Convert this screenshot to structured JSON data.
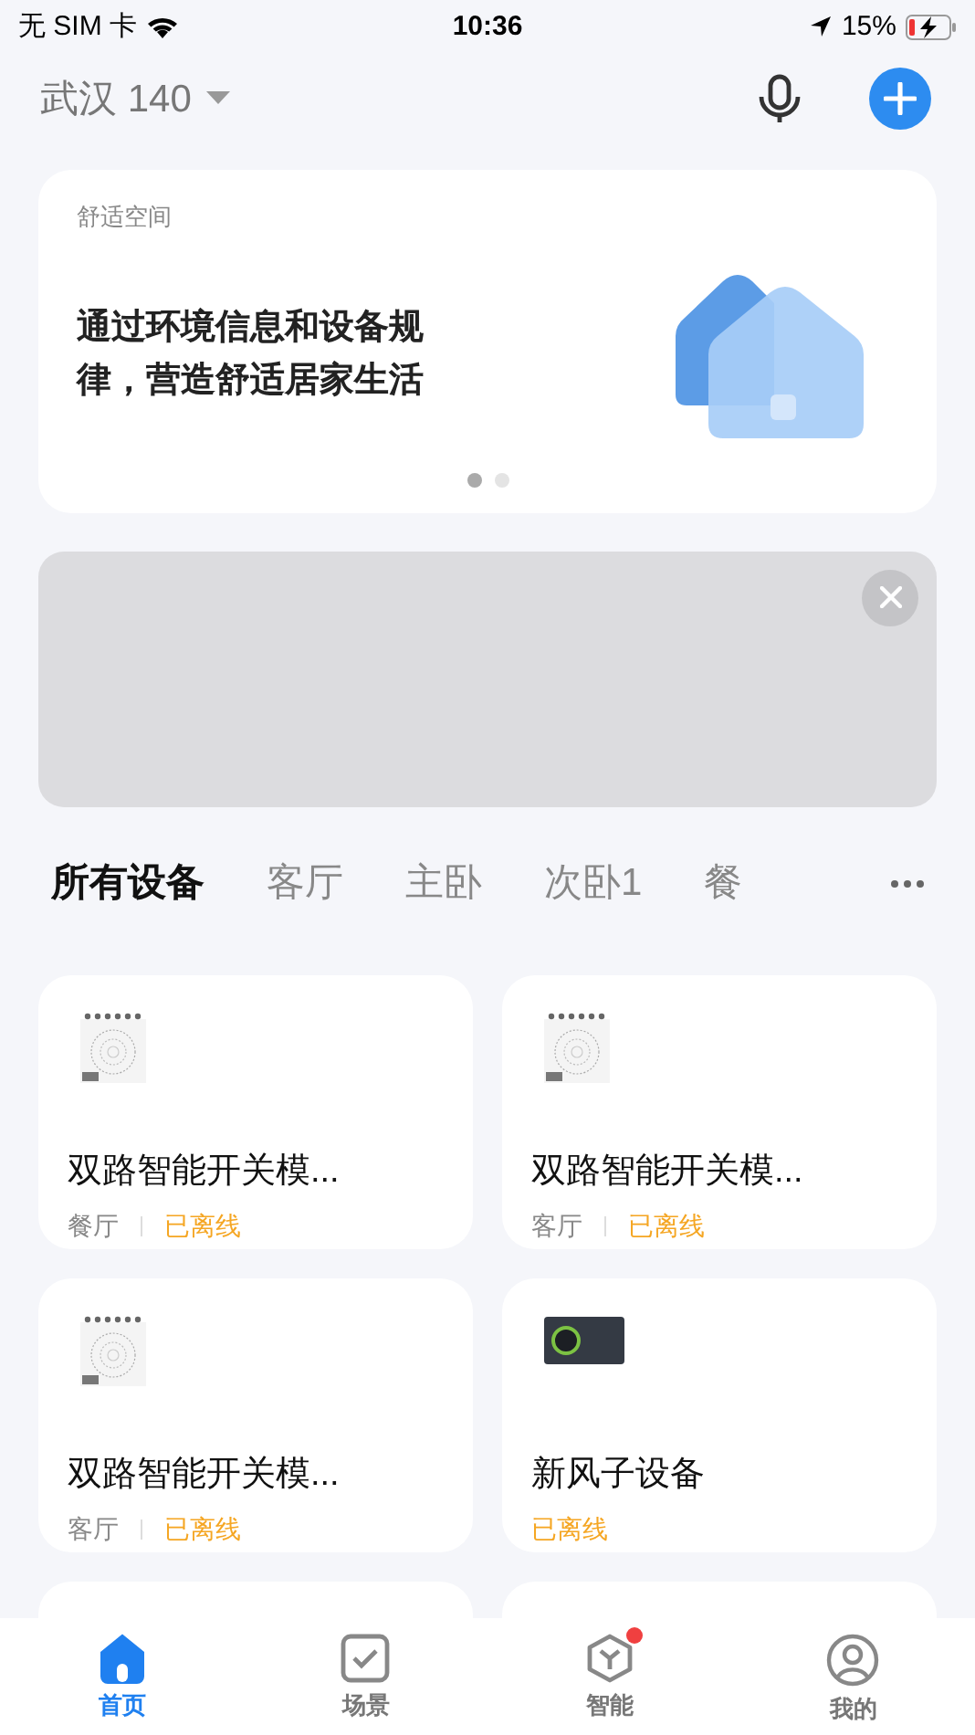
{
  "status_bar": {
    "carrier": "无 SIM 卡",
    "time": "10:36",
    "battery": "15%"
  },
  "header": {
    "home": "武汉 140"
  },
  "banner": {
    "label": "舒适空间",
    "text": "通过环境信息和设备规律，营造舒适居家生活",
    "pages": [
      {
        "selected": true
      },
      {
        "selected": false
      }
    ]
  },
  "rooms": [
    {
      "label": "所有设备",
      "selected": true
    },
    {
      "label": "客厅",
      "selected": false
    },
    {
      "label": "主卧",
      "selected": false
    },
    {
      "label": "次卧1",
      "selected": false
    },
    {
      "label": "餐",
      "selected": false
    }
  ],
  "devices": [
    {
      "kind": "switch",
      "name": "双路智能开关模...",
      "room": "餐厅",
      "status": "已离线"
    },
    {
      "kind": "switch",
      "name": "双路智能开关模...",
      "room": "客厅",
      "status": "已离线"
    },
    {
      "kind": "switch",
      "name": "双路智能开关模...",
      "room": "客厅",
      "status": "已离线"
    },
    {
      "kind": "fresh_air",
      "name": "新风子设备",
      "status": "已离线"
    }
  ],
  "tab_bar": [
    {
      "label": "首页",
      "kind": "home",
      "selected": true,
      "badge": false
    },
    {
      "label": "场景",
      "kind": "scene",
      "selected": false,
      "badge": false
    },
    {
      "label": "智能",
      "kind": "smart",
      "selected": false,
      "badge": true
    },
    {
      "label": "我的",
      "kind": "me",
      "selected": false,
      "badge": false
    }
  ]
}
